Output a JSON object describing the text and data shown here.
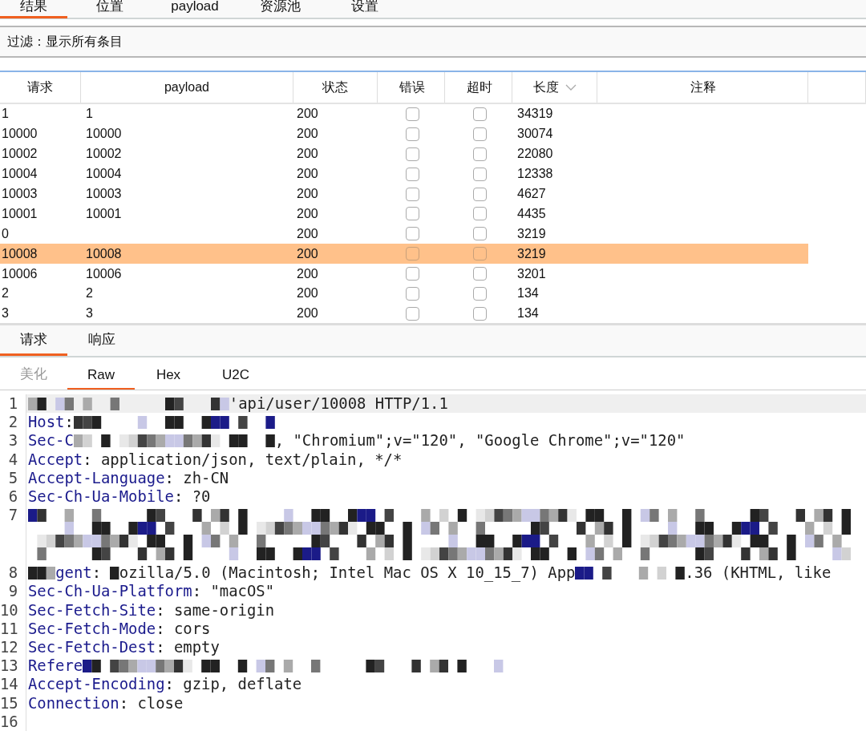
{
  "top_tabs": [
    {
      "label": "结果",
      "selected": true
    },
    {
      "label": "位置",
      "selected": false
    },
    {
      "label": "payload",
      "selected": false
    },
    {
      "label": "资源池",
      "selected": false
    },
    {
      "label": "设置",
      "selected": false
    }
  ],
  "filter": {
    "text": "过滤：显示所有条目"
  },
  "table": {
    "columns": [
      {
        "label": "请求",
        "sorted": false
      },
      {
        "label": "payload",
        "sorted": false
      },
      {
        "label": "状态",
        "sorted": false
      },
      {
        "label": "错误",
        "sorted": false
      },
      {
        "label": "超时",
        "sorted": false
      },
      {
        "label": "长度",
        "sorted": true
      },
      {
        "label": "注释",
        "sorted": false
      }
    ],
    "rows": [
      {
        "request": "1",
        "payload": "1",
        "status": "200",
        "error": false,
        "timeout": false,
        "length": "34319",
        "selected": false
      },
      {
        "request": "10000",
        "payload": "10000",
        "status": "200",
        "error": false,
        "timeout": false,
        "length": "30074",
        "selected": false
      },
      {
        "request": "10002",
        "payload": "10002",
        "status": "200",
        "error": false,
        "timeout": false,
        "length": "22080",
        "selected": false
      },
      {
        "request": "10004",
        "payload": "10004",
        "status": "200",
        "error": false,
        "timeout": false,
        "length": "12338",
        "selected": false
      },
      {
        "request": "10003",
        "payload": "10003",
        "status": "200",
        "error": false,
        "timeout": false,
        "length": "4627",
        "selected": false
      },
      {
        "request": "10001",
        "payload": "10001",
        "status": "200",
        "error": false,
        "timeout": false,
        "length": "4435",
        "selected": false
      },
      {
        "request": "0",
        "payload": "",
        "status": "200",
        "error": false,
        "timeout": false,
        "length": "3219",
        "selected": false
      },
      {
        "request": "10008",
        "payload": "10008",
        "status": "200",
        "error": false,
        "timeout": false,
        "length": "3219",
        "selected": true
      },
      {
        "request": "10006",
        "payload": "10006",
        "status": "200",
        "error": false,
        "timeout": false,
        "length": "3201",
        "selected": false
      },
      {
        "request": "2",
        "payload": "2",
        "status": "200",
        "error": false,
        "timeout": false,
        "length": "134",
        "selected": false
      },
      {
        "request": "3",
        "payload": "3",
        "status": "200",
        "error": false,
        "timeout": false,
        "length": "134",
        "selected": false
      }
    ]
  },
  "message_tabs": [
    {
      "label": "请求",
      "selected": true
    },
    {
      "label": "响应",
      "selected": false
    }
  ],
  "view_tabs": [
    {
      "label": "美化",
      "selected": false,
      "disabled": true
    },
    {
      "label": "Raw",
      "selected": true,
      "disabled": false
    },
    {
      "label": "Hex",
      "selected": false,
      "disabled": false
    },
    {
      "label": "U2C",
      "selected": false,
      "disabled": false
    }
  ],
  "editor": {
    "lines": [
      {
        "number": "1",
        "highlighted": true,
        "segments": [
          {
            "kind": "mosaic_long"
          },
          {
            "kind": "text",
            "text": "'api/user/10008 HTTP/1.1"
          }
        ]
      },
      {
        "number": "2",
        "highlighted": false,
        "segments": [
          {
            "kind": "key",
            "text": "Host"
          },
          {
            "kind": "text",
            "text": ":"
          },
          {
            "kind": "mosaic_long"
          }
        ]
      },
      {
        "number": "3",
        "highlighted": false,
        "segments": [
          {
            "kind": "key",
            "text": "Sec-C"
          },
          {
            "kind": "mosaic_long"
          },
          {
            "kind": "text",
            "text": ", \"Chromium\";v=\"120\", \"Google Chrome\";v=\"120\""
          }
        ]
      },
      {
        "number": "4",
        "highlighted": false,
        "segments": [
          {
            "kind": "key",
            "text": "Accept"
          },
          {
            "kind": "text",
            "text": ": application/json, text/plain, */*"
          }
        ]
      },
      {
        "number": "5",
        "highlighted": false,
        "segments": [
          {
            "kind": "key",
            "text": "Accept-Language"
          },
          {
            "kind": "text",
            "text": ": zh-CN"
          }
        ]
      },
      {
        "number": "6",
        "highlighted": false,
        "segments": [
          {
            "kind": "key",
            "text": "Sec-Ch-Ua-Mobile"
          },
          {
            "kind": "text",
            "text": ": ?0"
          }
        ]
      },
      {
        "number": "7",
        "highlighted": false,
        "segments": [
          {
            "kind": "mosaic_block"
          }
        ]
      },
      {
        "number": "8",
        "highlighted": false,
        "segments": [
          {
            "kind": "mosaic_short"
          },
          {
            "kind": "key",
            "text": "gent"
          },
          {
            "kind": "text",
            "text": ": "
          },
          {
            "kind": "mosaic_tiny"
          },
          {
            "kind": "text",
            "text": "ozilla/5.0 (Macintosh; Intel Mac OS X 10_15_7) App"
          },
          {
            "kind": "mosaic"
          },
          {
            "kind": "text",
            "text": ".36 (KHTML, like"
          }
        ]
      },
      {
        "number": "9",
        "highlighted": false,
        "segments": [
          {
            "kind": "key",
            "text": "Sec-Ch-Ua-Platform"
          },
          {
            "kind": "text",
            "text": ": \"macOS\""
          }
        ]
      },
      {
        "number": "10",
        "highlighted": false,
        "segments": [
          {
            "kind": "key",
            "text": "Sec-Fetch-Site"
          },
          {
            "kind": "text",
            "text": ": same-origin"
          }
        ]
      },
      {
        "number": "11",
        "highlighted": false,
        "segments": [
          {
            "kind": "key",
            "text": "Sec-Fetch-Mode"
          },
          {
            "kind": "text",
            "text": ": cors"
          }
        ]
      },
      {
        "number": "12",
        "highlighted": false,
        "segments": [
          {
            "kind": "key",
            "text": "Sec-Fetch-Dest"
          },
          {
            "kind": "text",
            "text": ": empty"
          }
        ]
      },
      {
        "number": "13",
        "highlighted": false,
        "segments": [
          {
            "kind": "key",
            "text": "Refere"
          },
          {
            "kind": "mosaic_wide"
          }
        ]
      },
      {
        "number": "14",
        "highlighted": false,
        "segments": [
          {
            "kind": "key",
            "text": "Accept-Encoding"
          },
          {
            "kind": "text",
            "text": ": gzip, deflate"
          }
        ]
      },
      {
        "number": "15",
        "highlighted": false,
        "segments": [
          {
            "kind": "key",
            "text": "Connection"
          },
          {
            "kind": "text",
            "text": ": close"
          }
        ]
      },
      {
        "number": "16",
        "highlighted": false
      }
    ]
  }
}
